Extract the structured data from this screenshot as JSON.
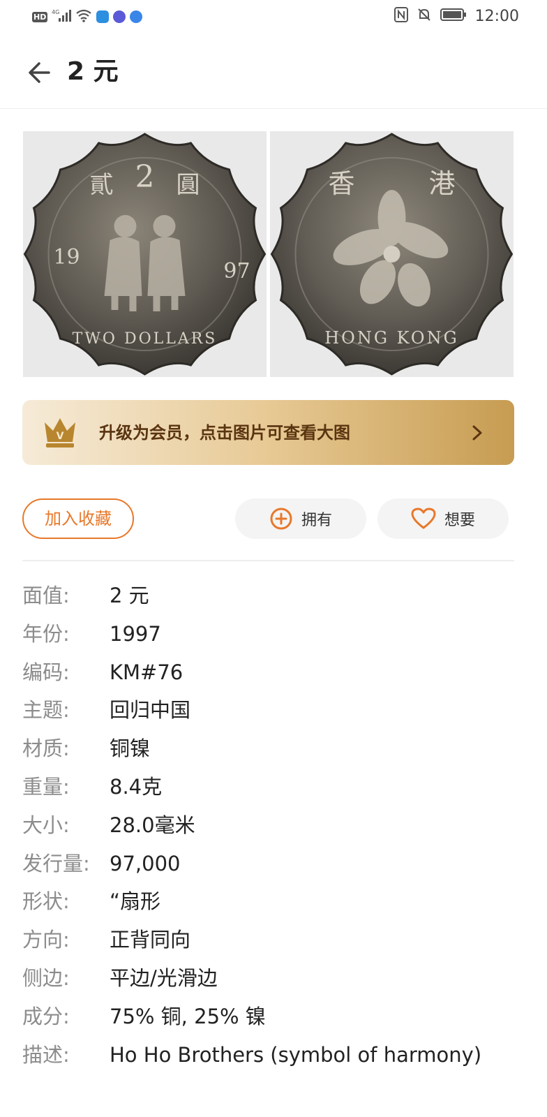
{
  "status_bar": {
    "hd": "HD",
    "network": "4G",
    "time": "12:00"
  },
  "header": {
    "title": "2 元"
  },
  "coin_images": {
    "obverse": {
      "top_text_left": "貳",
      "top_text_center": "2",
      "top_text_right": "圓",
      "year_left": "19",
      "year_right": "97",
      "bottom_text": "TWO DOLLARS"
    },
    "reverse": {
      "top_text_left": "香",
      "top_text_right": "港",
      "bottom_text": "HONG KONG"
    }
  },
  "vip_banner": {
    "text": "升级为会员，点击图片可查看大图",
    "crown_letter": "V"
  },
  "actions": {
    "favorite": "加入收藏",
    "own": "拥有",
    "want": "想要"
  },
  "details": [
    {
      "key": "面值:",
      "value": "2 元"
    },
    {
      "key": "年份:",
      "value": "1997"
    },
    {
      "key": "编码:",
      "value": "KM#76"
    },
    {
      "key": "主题:",
      "value": "回归中国"
    },
    {
      "key": "材质:",
      "value": "铜镍"
    },
    {
      "key": "重量:",
      "value": "8.4克"
    },
    {
      "key": "大小:",
      "value": "28.0毫米"
    },
    {
      "key": "发行量:",
      "value": "97,000"
    },
    {
      "key": "形状:",
      "value": "“扇形"
    },
    {
      "key": "方向:",
      "value": "正背同向"
    },
    {
      "key": "侧边:",
      "value": "平边/光滑边"
    },
    {
      "key": "成分:",
      "value": "75% 铜, 25% 镍"
    },
    {
      "key": "描述:",
      "value": "Ho Ho Brothers (symbol of harmony)"
    }
  ],
  "colors": {
    "accent_orange": "#e8782a",
    "vip_text": "#5a3410",
    "key_gray": "#8c8c8c"
  }
}
